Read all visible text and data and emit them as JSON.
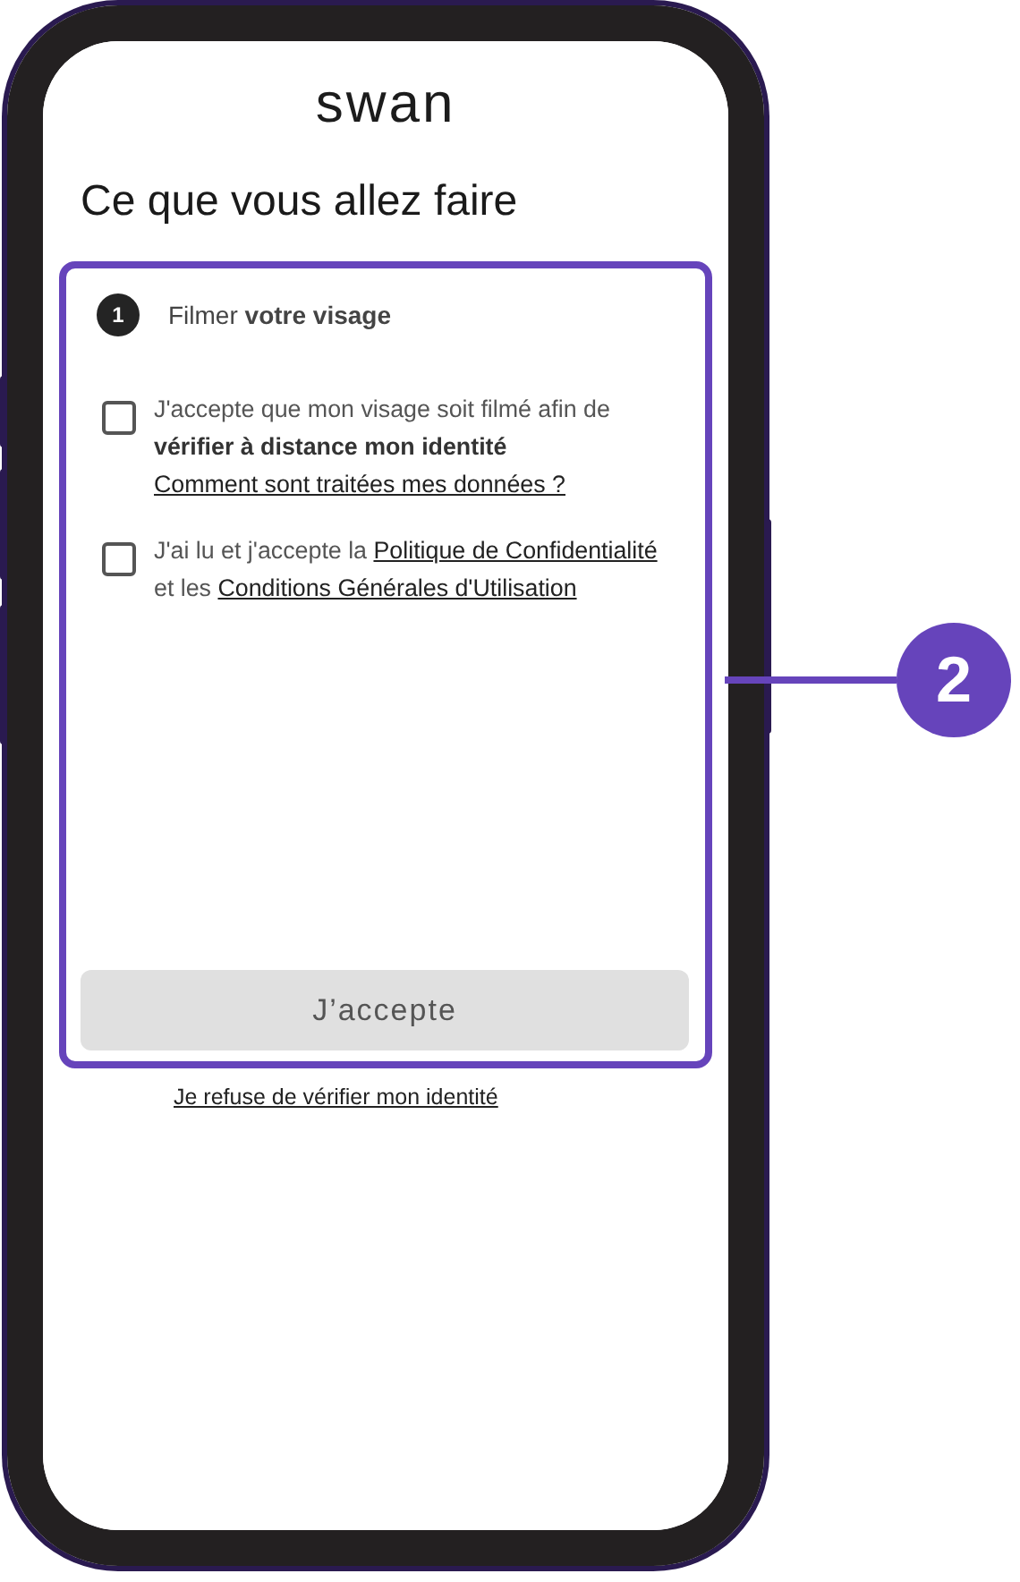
{
  "logo": "swan",
  "title": "Ce que vous allez faire",
  "step": {
    "number": "1",
    "label": "Filmer **votre visage**"
  },
  "consents": [
    {
      "checked": false,
      "parts": [
        {
          "kind": "text",
          "text": "J'accepte que mon visage soit filmé afin de **vérifier à distance mon identité**"
        }
      ],
      "link": "Comment sont traitées mes données ?"
    },
    {
      "checked": false,
      "parts": [
        {
          "kind": "text",
          "text": "J'ai lu et j'accepte la "
        },
        {
          "kind": "link",
          "text": "Politique de Confidentialité"
        },
        {
          "kind": "text",
          "text": " et les "
        },
        {
          "kind": "link",
          "text": "Conditions Générales d'Utilisation"
        }
      ]
    }
  ],
  "button": {
    "label": "J’accepte",
    "disabled": true
  },
  "refuse_link": "Je refuse de vérifier mon identité",
  "callout": {
    "number": "2"
  }
}
